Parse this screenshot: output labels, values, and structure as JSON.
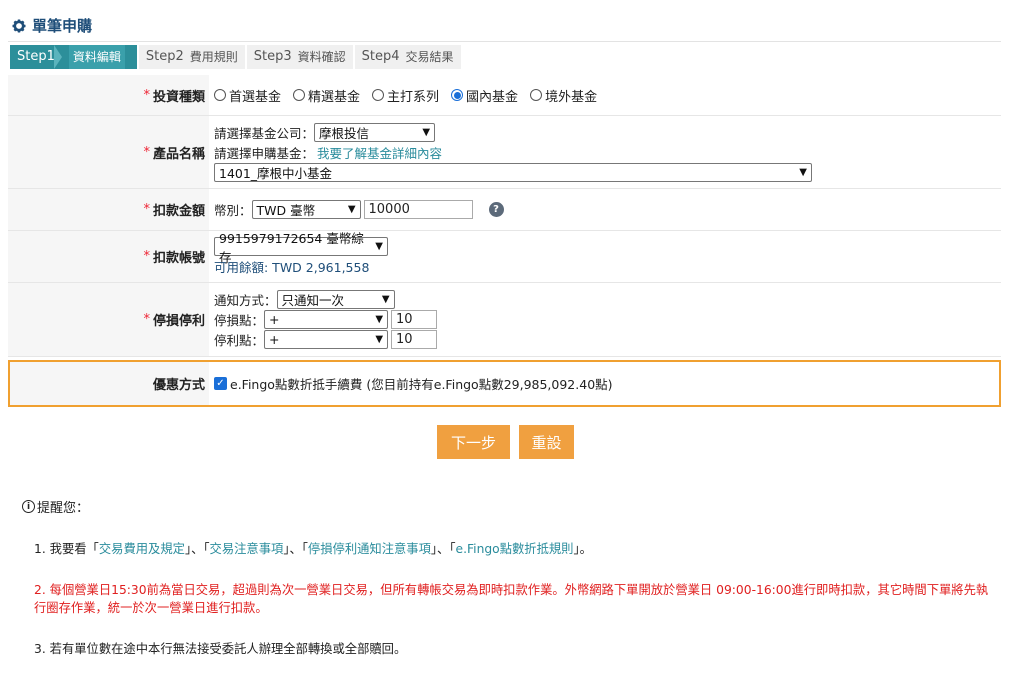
{
  "header": {
    "title": "單筆申購"
  },
  "steps": [
    {
      "num": "Step1",
      "label": "資料編輯"
    },
    {
      "num": "Step2",
      "label": "費用規則"
    },
    {
      "num": "Step3",
      "label": "資料確認"
    },
    {
      "num": "Step4",
      "label": "交易結果"
    }
  ],
  "form": {
    "investment_type": {
      "label": "投資種類",
      "options": [
        "首選基金",
        "精選基金",
        "主打系列",
        "國內基金",
        "境外基金"
      ],
      "selected": "國內基金"
    },
    "product": {
      "label": "產品名稱",
      "company_prompt": "請選擇基金公司：",
      "company_value": "摩根投信",
      "fund_prompt": "請選擇申購基金：",
      "fund_link": "我要了解基金詳細內容",
      "fund_value": "1401_摩根中小基金"
    },
    "amount": {
      "label": "扣款金額",
      "currency_prompt": "幣別：",
      "currency_value": "TWD 臺幣",
      "amount_value": "10000"
    },
    "account": {
      "label": "扣款帳號",
      "account_value": "9915979172654 臺幣綜存",
      "balance": "可用餘額: TWD 2,961,558"
    },
    "stop": {
      "label": "停損停利",
      "notify_prompt": "通知方式：",
      "notify_value": "只通知一次",
      "loss_prompt": "停損點：",
      "loss_sign": "+",
      "loss_value": "10",
      "profit_prompt": "停利點：",
      "profit_sign": "+",
      "profit_value": "10"
    },
    "discount": {
      "label": "優惠方式",
      "text": "e.Fingo點數折抵手續費 (您目前持有e.Fingo點數29,985,092.40點)",
      "checked": true
    }
  },
  "buttons": {
    "next": "下一步",
    "reset": "重設"
  },
  "notice": {
    "head": "提醒您：",
    "note1_prefix": "1. 我要看「",
    "note1_link1": "交易費用及規定",
    "note1_sep1": "」、「",
    "note1_link2": "交易注意事項",
    "note1_sep2": "」、「",
    "note1_link3": "停損停利通知注意事項",
    "note1_sep3": "」、「",
    "note1_link4": "e.Fingo點數折抵規則",
    "note1_suffix": "」。",
    "note2": "2. 每個營業日15:30前為當日交易，超過則為次一營業日交易，但所有轉帳交易為即時扣款作業。外幣網路下單開放於營業日 09:00-16:00進行即時扣款，其它時間下單將先執行圈存作業，統一於次一營業日進行扣款。",
    "note3": "3. 若有單位數在途中本行無法接受委託人辦理全部轉換或全部贖回。"
  },
  "colors": {
    "accent": "#2c8f9a",
    "button": "#f0a040",
    "highlight_border": "#f0a030",
    "warning": "#e02020"
  }
}
